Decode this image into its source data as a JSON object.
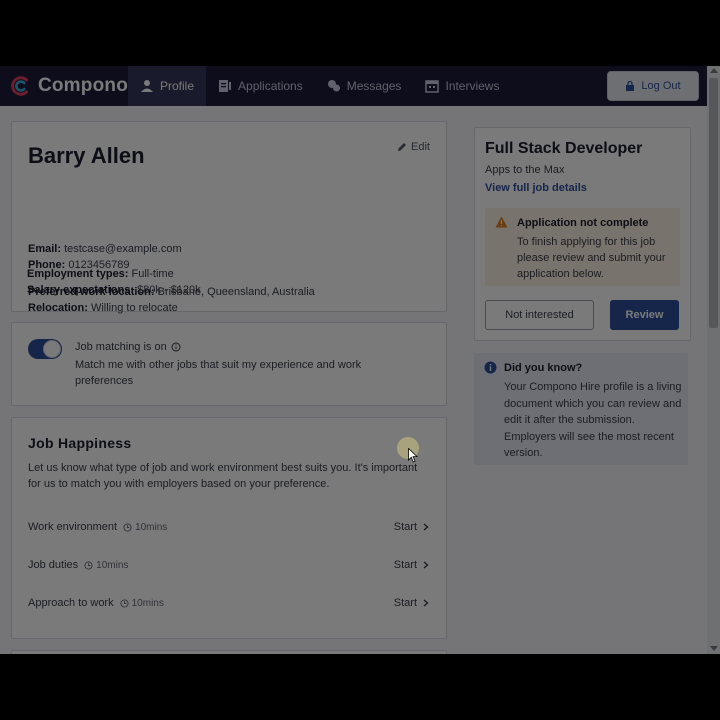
{
  "brand": {
    "name": "Compono"
  },
  "nav": {
    "tabs": [
      {
        "label": "Profile",
        "icon": "user-icon",
        "active": true
      },
      {
        "label": "Applications",
        "icon": "applications-icon",
        "active": false
      },
      {
        "label": "Messages",
        "icon": "messages-icon",
        "active": false
      },
      {
        "label": "Interviews",
        "icon": "calendar-icon",
        "active": false
      }
    ],
    "logout_label": "Log Out"
  },
  "profile": {
    "name": "Barry Allen",
    "edit_label": "Edit",
    "email_label": "Email:",
    "email": "testcase@example.com",
    "phone_label": "Phone:",
    "phone": "0123456789",
    "location_label": "Preferred work location:",
    "location": "Brisbane, Queensland, Australia",
    "relocation_label": "Relocation:",
    "relocation": "Willing to relocate",
    "employment_label": "Employment types:",
    "employment": "Full-time",
    "salary_label": "Salary expectations:",
    "salary": "$80k - $120k"
  },
  "matching": {
    "enabled": true,
    "title": "Job matching is on",
    "description": "Match me with other jobs that suit my experience and work preferences"
  },
  "happiness": {
    "title": "Job Happiness",
    "description": "Let us know what type of job and work environment best suits you. It's important for us to match you with employers based on your preference.",
    "start_label": "Start",
    "tasks": [
      {
        "label": "Work environment",
        "time": "10mins"
      },
      {
        "label": "Job duties",
        "time": "10mins"
      },
      {
        "label": "Approach to work",
        "time": "10mins"
      }
    ]
  },
  "job": {
    "title": "Full Stack Developer",
    "company": "Apps to the Max",
    "details_link": "View full job details",
    "warning_title": "Application not complete",
    "warning_text": "To finish applying for this job please review and submit your application below.",
    "not_interested_label": "Not interested",
    "review_label": "Review"
  },
  "info": {
    "title": "Did you know?",
    "text": "Your Compono Hire profile is a living document which you can review and edit it after the submission. Employers will see the most recent version."
  },
  "colors": {
    "nav_bg": "#1c1d3a",
    "primary": "#2f4e9c",
    "warning_bg": "#fbf1e1",
    "warning_icon": "#d9822b",
    "info_bg": "#e7e9f4"
  }
}
